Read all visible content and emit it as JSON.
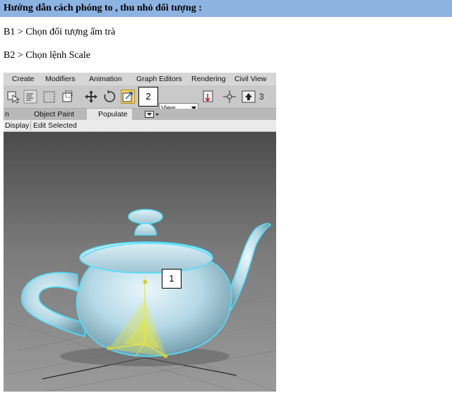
{
  "heading": "Hướng dẫn cách phóng to , thu nhỏ đối tượng :",
  "steps": {
    "step1": "B1 > Chọn đối tượng ấm trà",
    "step2": "B2 > Chọn lệnh Scale"
  },
  "screenshot": {
    "menu": {
      "create": "Create",
      "modifiers": "Modifiers",
      "animation": "Animation",
      "graph_editors": "Graph Editors",
      "rendering": "Rendering",
      "civil_view": "Civil View"
    },
    "toolbar": {
      "view_dropdown": "View",
      "snap_number": "3"
    },
    "ribbon": {
      "partial_tab": "n",
      "object_paint": "Object Paint",
      "populate": "Populate"
    },
    "subbar": {
      "display": "Display",
      "edit_selected": "Edit Selected"
    },
    "gizmo_axis": "z",
    "callouts": {
      "scale_callout": "2",
      "object_callout": "1"
    }
  },
  "colors": {
    "heading_bg": "#8db3e2",
    "teapot": "#b5d9e6",
    "selection_outline": "#4fe0ff",
    "gizmo": "#e8e840"
  }
}
